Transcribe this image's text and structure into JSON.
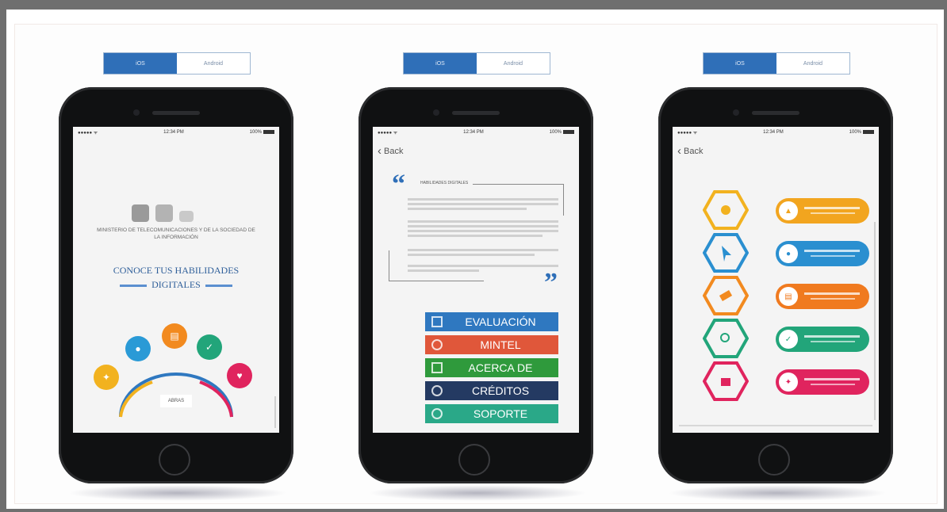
{
  "screens": [
    {
      "tabs": [
        "iOS",
        "Android"
      ],
      "status": {
        "carrier": "●●●●● ᯤ",
        "time": "12:34 PM",
        "battery": "100%"
      },
      "ministry": "MINISTERIO DE TELECOMUNICACIONES Y DE LA SOCIEDAD DE LA INFORMACIÓN",
      "headline_1": "CONOCE TUS HABILIDADES",
      "headline_2": "DIGITALES",
      "arc_label": "ABRAS"
    },
    {
      "tabs": [
        "iOS",
        "Android"
      ],
      "status": {
        "carrier": "●●●●● ᯤ",
        "time": "12:34 PM",
        "battery": "100%"
      },
      "back_label": "Back",
      "quote_title": "HABILIDADES DIGITALES",
      "menu": [
        {
          "label": "EVALUACIÓN",
          "color": "#2f78c0",
          "icon": "list-icon"
        },
        {
          "label": "MINTEL",
          "color": "#e0573a",
          "icon": "mintel-logo-icon"
        },
        {
          "label": "ACERCA DE",
          "color": "#2f9a3c",
          "icon": "info-icon"
        },
        {
          "label": "CRÉDITOS",
          "color": "#243a62",
          "icon": "credits-icon"
        },
        {
          "label": "SOPORTE",
          "color": "#2aa888",
          "icon": "whatsapp-icon"
        }
      ]
    },
    {
      "tabs": [
        "iOS",
        "Android"
      ],
      "status": {
        "carrier": "●●●●● ᯤ",
        "time": "12:34 PM",
        "battery": "100%"
      },
      "back_label": "Back",
      "hexagons": [
        {
          "color": "#f2b21f",
          "icon": "link-icon"
        },
        {
          "color": "#2a8fd0",
          "icon": "cursor-icon"
        },
        {
          "color": "#f28a1f",
          "icon": "pencil-icon"
        },
        {
          "color": "#22a57a",
          "icon": "search-icon"
        },
        {
          "color": "#e0245e",
          "icon": "shopping-bag-icon"
        }
      ],
      "pills": [
        {
          "color": "#f2a51f",
          "icon": "chart-icon"
        },
        {
          "color": "#2a8fd0",
          "icon": "group-icon"
        },
        {
          "color": "#f07a1f",
          "icon": "document-icon"
        },
        {
          "color": "#22a57a",
          "icon": "shield-icon"
        },
        {
          "color": "#e0245e",
          "icon": "lightbulb-icon"
        }
      ]
    }
  ]
}
